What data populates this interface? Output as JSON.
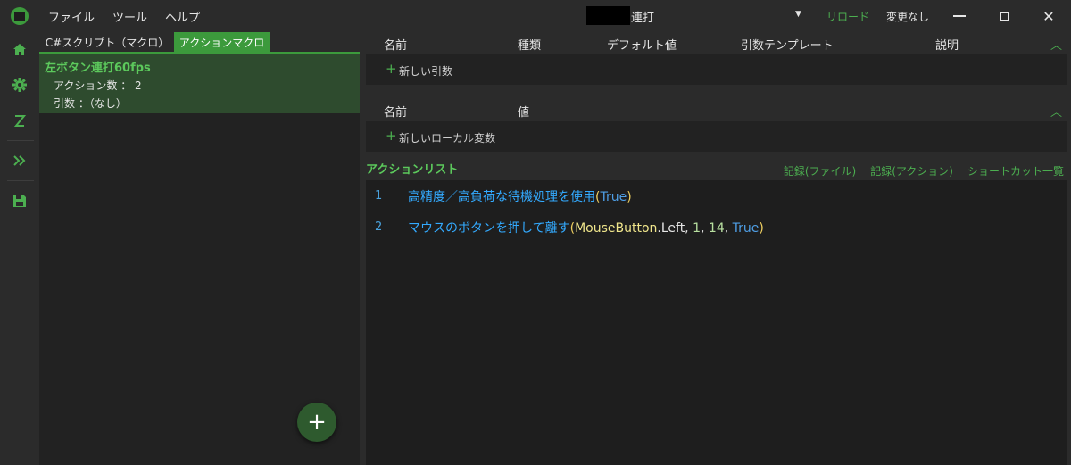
{
  "titlebar": {
    "menu": [
      "ファイル",
      "ツール",
      "ヘルプ"
    ],
    "title": "連打",
    "reload": "リロード",
    "status": "変更なし",
    "close_glyph": "✕"
  },
  "rail": {
    "icons": [
      "home-icon",
      "gear-icon",
      "z-icon",
      "double-chevron-icon",
      "save-icon"
    ]
  },
  "left": {
    "tabs": [
      "C#スクリプト（マクロ）",
      "アクションマクロ"
    ],
    "macro": {
      "name": "左ボタン連打60fps",
      "action_count": "アクション数 ： 2",
      "args": "引数 ：（なし）"
    },
    "fab_label": "+"
  },
  "args_table": {
    "headers": [
      "名前",
      "種類",
      "デフォルト値",
      "引数テンプレート",
      "説明"
    ],
    "add_label": "新しい引数"
  },
  "locals_table": {
    "headers": [
      "名前",
      "値"
    ],
    "add_label": "新しいローカル変数"
  },
  "action_list": {
    "title": "アクションリスト",
    "links": [
      "記録(ファイル)",
      "記録(アクション)",
      "ショートカット一覧"
    ],
    "lines": [
      {
        "num": "1",
        "method": "高精度／高負荷な待機処理を使用",
        "open": "(",
        "a1": "True",
        "close": ")"
      },
      {
        "num": "2",
        "method": "マウスのボタンを押して離す",
        "open": "(",
        "type": "MouseButton",
        "member": ".Left, ",
        "n1": "1",
        "sep1": ", ",
        "n2": "14",
        "sep2": ", ",
        "a1": "True",
        "close": ")"
      }
    ]
  },
  "colors": {
    "accent": "#3c9a3c",
    "accent_text": "#5cc95c",
    "method": "#33aaff",
    "keyword": "#4f9fe6"
  }
}
